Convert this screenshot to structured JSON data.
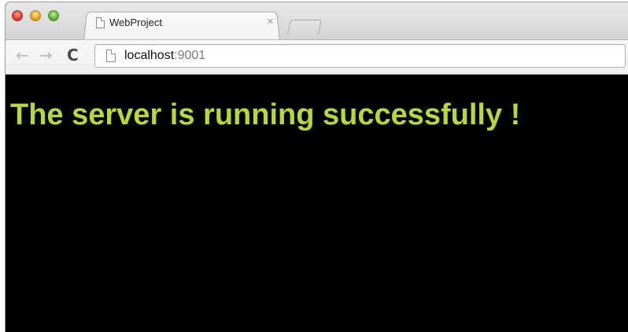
{
  "window": {
    "tab_title": "WebProject",
    "tab_close": "×"
  },
  "toolbar": {
    "back_glyph": "←",
    "forward_glyph": "→",
    "reload_glyph": "C",
    "url_host": "localhost",
    "url_port": ":9001"
  },
  "page": {
    "message": "The server is running successfully !",
    "message_color": "#b9d445",
    "background_color": "#000000"
  },
  "icons": {
    "close": "close-window-icon",
    "minimize": "minimize-window-icon",
    "zoom": "zoom-window-icon",
    "tab_page": "document-icon",
    "omnibox_page": "page-icon"
  }
}
